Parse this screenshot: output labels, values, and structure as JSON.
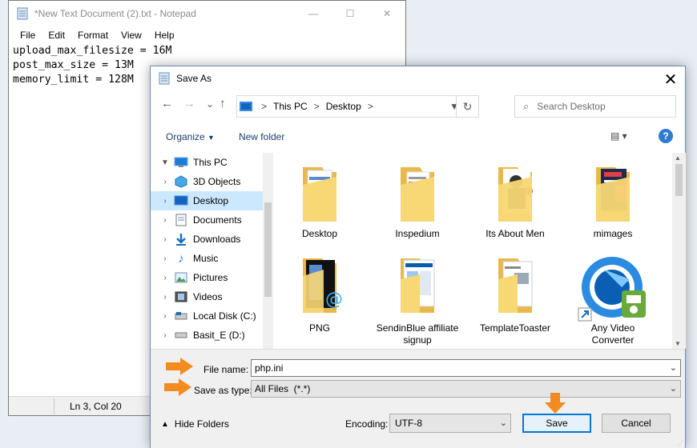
{
  "notepad": {
    "title": "*New Text Document (2).txt - Notepad",
    "window_controls": [
      "—",
      "☐",
      "✕"
    ],
    "menu": [
      "File",
      "Edit",
      "Format",
      "View",
      "Help"
    ],
    "lines": [
      "upload_max_filesize = 16M",
      "post_max_size = 13M",
      "memory_limit = 128M"
    ],
    "status": "Ln 3, Col 20"
  },
  "dialog": {
    "title": "Save As",
    "close": "✕",
    "nav": {
      "back": "←",
      "forward": "→",
      "recent": "⌄",
      "up": "↑"
    },
    "breadcrumb": [
      "This PC",
      "Desktop"
    ],
    "breadcrumb_sep": ">",
    "refresh": "↻",
    "search_placeholder": "Search Desktop",
    "toolbar": {
      "organize": "Organize",
      "new_folder": "New folder"
    },
    "sidebar": [
      {
        "label": "This PC",
        "icon": "pc-icon",
        "expanded": true
      },
      {
        "label": "3D Objects",
        "icon": "cube-icon"
      },
      {
        "label": "Desktop",
        "icon": "desktop-icon",
        "selected": true
      },
      {
        "label": "Documents",
        "icon": "documents-icon"
      },
      {
        "label": "Downloads",
        "icon": "download-icon"
      },
      {
        "label": "Music",
        "icon": "music-icon"
      },
      {
        "label": "Pictures",
        "icon": "pictures-icon"
      },
      {
        "label": "Videos",
        "icon": "videos-icon"
      },
      {
        "label": "Local Disk (C:)",
        "icon": "disk-icon"
      },
      {
        "label": "Basit_E (D:)",
        "icon": "drive-icon"
      }
    ],
    "files": [
      {
        "label": "Desktop",
        "type": "folder"
      },
      {
        "label": "Inspedium",
        "type": "folder"
      },
      {
        "label": "Its About Men",
        "type": "folder"
      },
      {
        "label": "mimages",
        "type": "folder"
      },
      {
        "label": "PNG",
        "type": "folder"
      },
      {
        "label": "SendinBlue affiliate signup",
        "type": "folder"
      },
      {
        "label": "TemplateToaster",
        "type": "folder"
      },
      {
        "label": "Any Video Converter",
        "type": "shortcut"
      }
    ],
    "file_name_label": "File name:",
    "file_name_value": "php.ini",
    "save_type_label": "Save as type:",
    "save_type_value": "All Files  (*.*)",
    "hide_folders": "Hide Folders",
    "encoding_label": "Encoding:",
    "encoding_value": "UTF-8",
    "save": "Save",
    "cancel": "Cancel"
  },
  "colors": {
    "accent": "#0078d7",
    "selection": "#cce8ff",
    "folder": "#f8d775",
    "annotation_arrow": "#f58a1f"
  }
}
